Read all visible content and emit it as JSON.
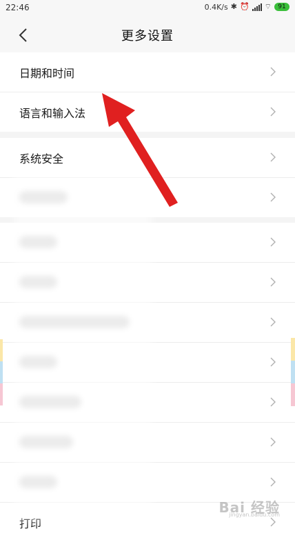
{
  "status_bar": {
    "time": "22:46",
    "net_speed": "0.4K/s",
    "battery_level": "91",
    "icons": [
      "bluetooth-icon",
      "alarm-off-icon",
      "signal-icon",
      "wifi-icon",
      "battery-icon"
    ]
  },
  "nav": {
    "title": "更多设置",
    "back_icon": "chevron-left-icon"
  },
  "groups": [
    {
      "items": [
        {
          "label": "日期和时间"
        },
        {
          "label": "语言和输入法"
        }
      ]
    },
    {
      "items": [
        {
          "label": "系统安全"
        },
        {
          "label": ""
        }
      ]
    },
    {
      "items": [
        {
          "label": ""
        },
        {
          "label": ""
        },
        {
          "label": ""
        },
        {
          "label": ""
        },
        {
          "label": ""
        },
        {
          "label": ""
        },
        {
          "label": ""
        },
        {
          "label": "打印"
        }
      ]
    }
  ],
  "annotation": {
    "color": "#e02020"
  },
  "watermark": {
    "text": "Bai 经验",
    "sub": "jingyan.baidu.com"
  },
  "colors": {
    "background": "#f4f4f4",
    "row_bg": "#ffffff",
    "chevron": "#b0b0b0"
  }
}
